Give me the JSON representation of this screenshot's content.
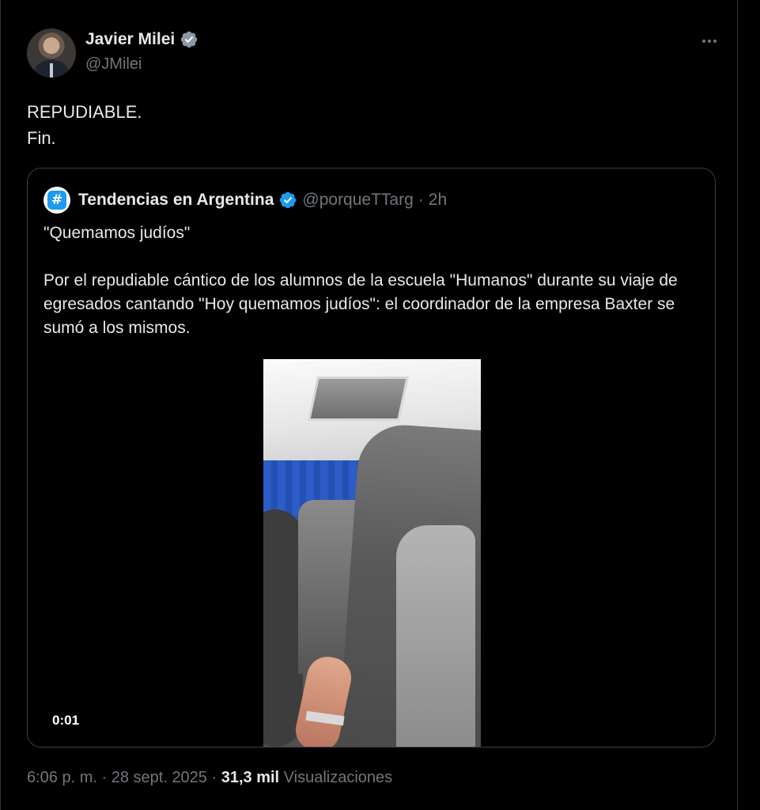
{
  "author": {
    "name": "Javier Milei",
    "handle": "@JMilei"
  },
  "tweet": {
    "line1": "REPUDIABLE.",
    "line2": "Fin."
  },
  "quoted": {
    "name": "Tendencias en Argentina",
    "handle": "@porqueTTarg",
    "separator": "·",
    "time": "2h",
    "avatar_glyph": "#",
    "paragraph1": "\"Quemamos judíos\"",
    "paragraph2": "Por el repudiable cántico de los alumnos de la escuela \"Humanos\" durante su viaje de egresados cantando \"Hoy quemamos judíos\": el coordinador de la empresa Baxter se sumó a los mismos.",
    "video_time": "0:01"
  },
  "meta": {
    "time": "6:06 p. m.",
    "sep1": " · ",
    "date": "28 sept. 2025",
    "sep2": " · ",
    "views_count": "31,3 mil",
    "views_label": " Visualizaciones"
  },
  "colors": {
    "background": "#000000",
    "text": "#e7e9ea",
    "secondary": "#71767b",
    "verified": "#1d9bf0",
    "border": "#3d4043"
  },
  "icons": {
    "verified": "verified-badge-icon",
    "more": "more-horizontal-icon",
    "quoted_avatar": "hashtag-icon"
  }
}
